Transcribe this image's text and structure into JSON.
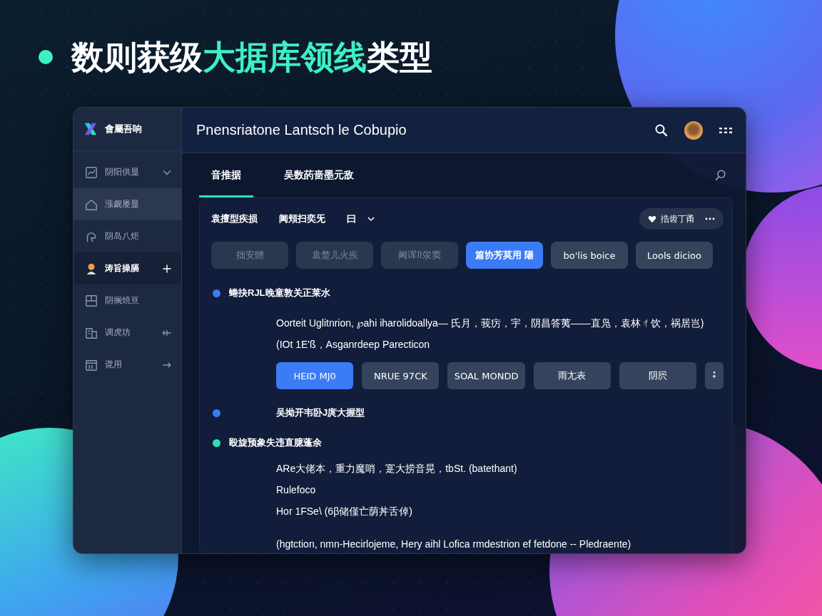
{
  "heading": [
    {
      "text": "数则获级",
      "accent": false
    },
    {
      "text": "大据库领线",
      "accent": true
    },
    {
      "text": "类型",
      "accent": false
    }
  ],
  "window": {
    "brand": "會屬吾响",
    "title": "Pnensriatone Lantsch le Cobupio"
  },
  "sidebar": {
    "items": [
      {
        "label": "阴阳供显",
        "selected": false,
        "hovered": false
      },
      {
        "label": "漲觑屡显",
        "selected": false,
        "hovered": true
      },
      {
        "label": "阴岛八炬",
        "selected": false,
        "hovered": false
      },
      {
        "label": "涛旨操膈",
        "selected": true,
        "hovered": false
      },
      {
        "label": "阴搁焼亘",
        "selected": false,
        "hovered": false
      },
      {
        "label": "调虎坊",
        "selected": false,
        "hovered": false
      },
      {
        "label": "谠用",
        "selected": false,
        "hovered": false
      }
    ]
  },
  "tabs": [
    {
      "label": "音推据",
      "selected": true
    },
    {
      "label": "吴数菂啬墨元敌",
      "selected": false
    }
  ],
  "toolbar": {
    "filters": [
      "袁擅型疾损",
      "阃頬扫奕旡",
      "曰"
    ],
    "pill": "捁齿丁甬"
  },
  "chips": [
    {
      "label": "拙安體",
      "selected": false,
      "disabled": true
    },
    {
      "label": "袁楚儿火疾",
      "selected": false,
      "disabled": true
    },
    {
      "label": "阃诨ll泶窦",
      "selected": false,
      "disabled": true
    },
    {
      "label": "篇协芳莫用 陽",
      "selected": true,
      "disabled": false
    },
    {
      "label": "bo'lis boice",
      "selected": false,
      "disabled": false
    },
    {
      "label": "Lools dicioo",
      "selected": false,
      "disabled": false
    }
  ],
  "sections": [
    {
      "title": "蜷抉RJL晚童敦关正莱水",
      "color": "#3b7bf5",
      "lines": [
        "Oorteit Uglitnrion, ℘ahi iharolidoallya— 氏月，莪疠，宇，阴昌答荑——直凫，袁林ㄔ饮，祸居岂)",
        "(IOt 1E'ß，Asganrdeep Parecticon"
      ],
      "buttons": [
        {
          "label": "HEID MJ0",
          "selected": true
        },
        {
          "label": "NRUE 97CK",
          "selected": false
        },
        {
          "label": "SOAL MONDD",
          "selected": false
        },
        {
          "label": "雨尢表",
          "selected": false
        },
        {
          "label": "阴屄",
          "selected": false
        }
      ]
    },
    {
      "title": "吴拗开韦卧J庹大握型",
      "color": "#3b7bf5"
    },
    {
      "title": "殴旋预象失违直臆蓬余",
      "color": "#2de0b5",
      "lines": [
        "ARe大佬本，重力魔哨，寔大捞音晃，tbSt. (batethant)",
        "Rulefoco",
        "Hor 1FSe\\ (6β储僅亡荫丼舌倬)"
      ],
      "footnote": "(hgtction, nmn-Hecirlojeme, Hery aihl Lofica rmdestrion ef fetdone -- Pledraente)"
    }
  ]
}
